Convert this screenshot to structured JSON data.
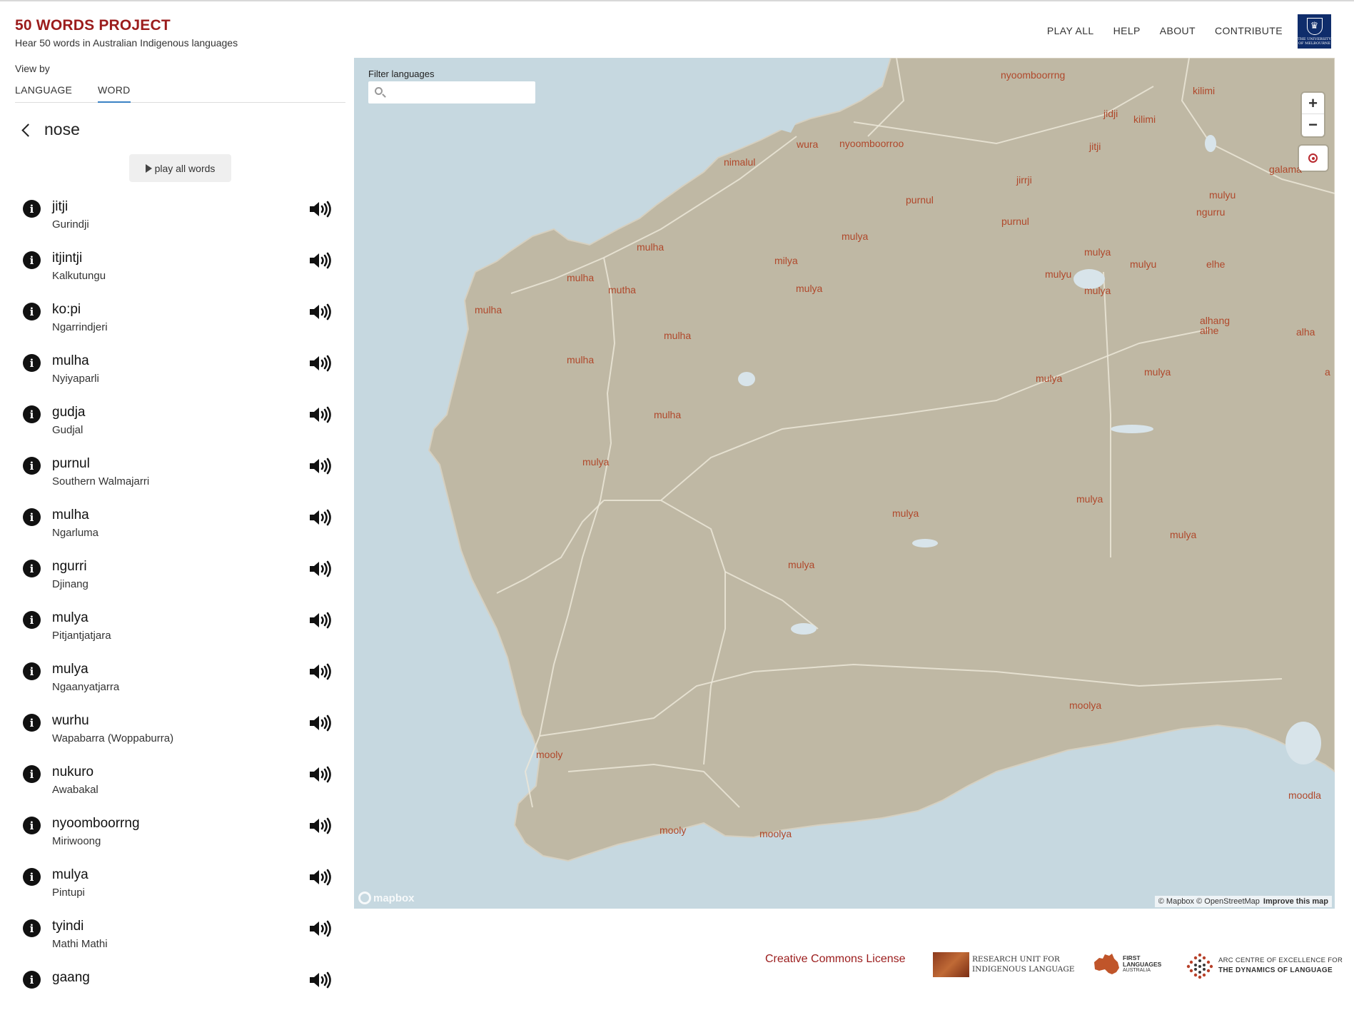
{
  "header": {
    "title": "50 WORDS PROJECT",
    "subtitle": "Hear 50 words in Australian Indigenous languages",
    "nav": [
      "PLAY ALL",
      "HELP",
      "ABOUT",
      "CONTRIBUTE"
    ],
    "logo_text": "THE UNIVERSITY OF MELBOURNE"
  },
  "sidebar": {
    "view_by_label": "View by",
    "tabs": [
      {
        "label": "LANGUAGE",
        "active": false
      },
      {
        "label": "WORD",
        "active": true
      }
    ],
    "current_word": "nose",
    "play_all_label": "play all words",
    "entries": [
      {
        "word": "jitji",
        "language": "Gurindji"
      },
      {
        "word": "itjintji",
        "language": "Kalkutungu"
      },
      {
        "word": "ko:pi",
        "language": "Ngarrindjeri"
      },
      {
        "word": "mulha",
        "language": "Nyiyaparli"
      },
      {
        "word": "gudja",
        "language": "Gudjal"
      },
      {
        "word": "purnul",
        "language": "Southern Walmajarri"
      },
      {
        "word": "mulha",
        "language": "Ngarluma"
      },
      {
        "word": "ngurri",
        "language": "Djinang"
      },
      {
        "word": "mulya",
        "language": "Pitjantjatjara"
      },
      {
        "word": "mulya",
        "language": "Ngaanyatjarra"
      },
      {
        "word": "wurhu",
        "language": "Wapabarra (Woppaburra)"
      },
      {
        "word": "nukuro",
        "language": "Awabakal"
      },
      {
        "word": "nyoomboorrng",
        "language": "Miriwoong"
      },
      {
        "word": "mulya",
        "language": "Pintupi"
      },
      {
        "word": "tyindi",
        "language": "Mathi Mathi"
      },
      {
        "word": "gaang",
        "language": ""
      }
    ]
  },
  "map": {
    "filter_label": "Filter languages",
    "filter_value": "",
    "zoom_in": "+",
    "zoom_out": "−",
    "mapbox_wordmark": "mapbox",
    "attribution": "© Mapbox © OpenStreetMap",
    "improve_link": "Improve this map",
    "labels": [
      "nyoomboorrng",
      "kilimi",
      "jidji",
      "kilimi",
      "wura",
      "nyoomboorroo",
      "jitji",
      "nimalul",
      "galama",
      "jirrji",
      "purnul",
      "mulyu",
      "ngurru",
      "purnul",
      "mulya",
      "mulha",
      "milya",
      "mulya",
      "mulha",
      "mulyu",
      "mulyu",
      "elhe",
      "mutha",
      "mulya",
      "mulya",
      "mulha",
      "mulha",
      "alhang",
      "alhe",
      "alha",
      "mulha",
      "mulya",
      "mulya",
      "a",
      "mulha",
      "mulya",
      "mulya",
      "mulya",
      "mulya",
      "mulya",
      "moolya",
      "mooly",
      "moodla",
      "mooly",
      "moolya"
    ],
    "colors": {
      "water": "#c6d8e0",
      "land": "#bfb8a4",
      "label": "#b0482b"
    }
  },
  "footer": {
    "license_link": "Creative Commons License",
    "logo1_line1": "RESEARCH UNIT FOR",
    "logo1_line2": "INDIGENOUS LANGUAGE",
    "logo2_line1": "FIRST",
    "logo2_line2": "LANGUAGES",
    "logo2_line3": "AUSTRALIA",
    "logo3_line1": "ARC CENTRE OF EXCELLENCE FOR",
    "logo3_line2": "THE DYNAMICS OF LANGUAGE"
  }
}
